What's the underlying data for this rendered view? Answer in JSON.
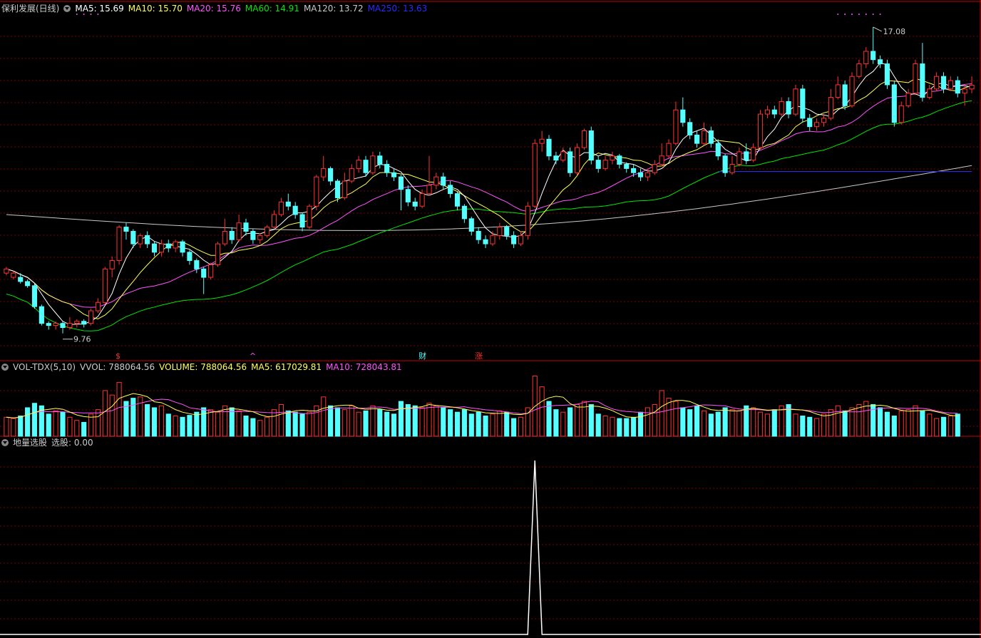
{
  "panel1": {
    "stock_name": "保利发展(日线)",
    "ma_labels": [
      {
        "text": "MA5: 15.69",
        "color": "#ffffff"
      },
      {
        "text": "MA10: 15.70",
        "color": "#ffff54"
      },
      {
        "text": "MA20: 15.76",
        "color": "#ff54ff"
      },
      {
        "text": "MA60: 14.91",
        "color": "#00e600"
      },
      {
        "text": "MA120: 13.72",
        "color": "#c8c8c8"
      },
      {
        "text": "MA250: 13.63",
        "color": "#2a2aff"
      }
    ],
    "high_label": "17.08",
    "low_label": "9.76",
    "event_markers": [
      "$",
      "^",
      "财",
      "涨"
    ]
  },
  "panel2": {
    "indicator_name": "VOL-TDX(5,10)",
    "labels": [
      {
        "text": "VVOL: 788064.56",
        "color": "#cccccc"
      },
      {
        "text": "VOLUME: 788064.56",
        "color": "#ffff54"
      },
      {
        "text": "MA5: 617029.81",
        "color": "#ffff54"
      },
      {
        "text": "MA10: 728043.81",
        "color": "#ff54ff"
      }
    ]
  },
  "panel3": {
    "indicator_name": "地量选股",
    "label": "选股: 0.00"
  },
  "chart_data": {
    "type": "candlestick",
    "price_range": [
      9.5,
      17.3
    ],
    "colors": {
      "up": "#ff3232",
      "down": "#54ffff",
      "grid": "#7a0000",
      "border": "#c80000"
    },
    "candles": [
      [
        11.2,
        11.3,
        11.15,
        11.35
      ],
      [
        11.1,
        11.2,
        11.05,
        11.25
      ],
      [
        11.1,
        11.0,
        10.95,
        11.2
      ],
      [
        11.0,
        10.9,
        10.85,
        11.05
      ],
      [
        10.9,
        10.4,
        10.35,
        10.95
      ],
      [
        10.4,
        10.0,
        9.95,
        10.45
      ],
      [
        10.0,
        9.95,
        9.85,
        10.05
      ],
      [
        9.95,
        10.0,
        9.85,
        10.05
      ],
      [
        10.0,
        9.9,
        9.76,
        10.05
      ],
      [
        9.9,
        10.0,
        9.85,
        10.15
      ],
      [
        10.0,
        10.05,
        9.9,
        10.1
      ],
      [
        10.05,
        9.98,
        9.9,
        10.1
      ],
      [
        10.0,
        10.3,
        9.95,
        10.35
      ],
      [
        10.3,
        10.5,
        10.25,
        10.6
      ],
      [
        10.5,
        11.3,
        10.45,
        11.35
      ],
      [
        11.3,
        11.5,
        11.1,
        11.6
      ],
      [
        11.5,
        12.3,
        11.4,
        12.35
      ],
      [
        12.3,
        12.2,
        12.0,
        12.4
      ],
      [
        12.2,
        11.9,
        11.8,
        12.25
      ],
      [
        11.9,
        12.1,
        11.8,
        12.15
      ],
      [
        12.1,
        11.9,
        11.8,
        12.2
      ],
      [
        11.9,
        11.7,
        11.6,
        11.95
      ],
      [
        11.7,
        11.9,
        11.6,
        12.0
      ],
      [
        11.9,
        11.8,
        11.7,
        12.0
      ],
      [
        11.8,
        11.95,
        11.7,
        12.0
      ],
      [
        11.95,
        11.7,
        11.6,
        12.0
      ],
      [
        11.7,
        11.5,
        11.4,
        11.75
      ],
      [
        11.5,
        11.3,
        11.2,
        11.55
      ],
      [
        11.3,
        11.1,
        10.7,
        11.35
      ],
      [
        11.1,
        11.4,
        11.05,
        11.45
      ],
      [
        11.4,
        11.9,
        11.35,
        11.95
      ],
      [
        11.9,
        12.2,
        11.85,
        12.5
      ],
      [
        12.2,
        12.0,
        11.9,
        12.3
      ],
      [
        12.0,
        12.4,
        11.95,
        12.6
      ],
      [
        12.4,
        12.2,
        12.1,
        12.5
      ],
      [
        12.2,
        12.0,
        11.9,
        12.25
      ],
      [
        12.0,
        12.1,
        11.9,
        12.15
      ],
      [
        12.1,
        12.3,
        12.05,
        12.35
      ],
      [
        12.3,
        12.6,
        12.25,
        12.7
      ],
      [
        12.6,
        12.9,
        12.55,
        13.0
      ],
      [
        12.9,
        12.8,
        12.7,
        13.1
      ],
      [
        12.8,
        12.6,
        12.5,
        12.9
      ],
      [
        12.6,
        12.3,
        12.2,
        12.65
      ],
      [
        12.3,
        12.8,
        12.25,
        12.85
      ],
      [
        12.8,
        13.5,
        12.7,
        13.55
      ],
      [
        13.5,
        13.7,
        13.4,
        14.0
      ],
      [
        13.7,
        13.4,
        13.3,
        13.75
      ],
      [
        13.4,
        13.0,
        12.9,
        13.45
      ],
      [
        13.0,
        13.4,
        12.95,
        13.6
      ],
      [
        13.4,
        13.7,
        13.35,
        13.8
      ],
      [
        13.7,
        13.9,
        13.6,
        14.0
      ],
      [
        13.9,
        13.6,
        13.5,
        14.0
      ],
      [
        13.6,
        14.0,
        13.55,
        14.1
      ],
      [
        14.0,
        13.8,
        13.7,
        14.1
      ],
      [
        13.8,
        13.6,
        13.5,
        13.9
      ],
      [
        13.6,
        13.5,
        13.4,
        13.7
      ],
      [
        13.5,
        13.2,
        12.7,
        13.55
      ],
      [
        13.2,
        12.9,
        12.8,
        13.3
      ],
      [
        12.9,
        12.8,
        12.7,
        13.0
      ],
      [
        12.8,
        13.1,
        12.75,
        13.2
      ],
      [
        13.1,
        13.3,
        13.05,
        14.0
      ],
      [
        13.3,
        13.5,
        13.2,
        13.6
      ],
      [
        13.5,
        13.3,
        13.2,
        13.6
      ],
      [
        13.3,
        13.1,
        13.0,
        13.4
      ],
      [
        13.1,
        12.8,
        12.7,
        13.15
      ],
      [
        12.8,
        12.5,
        12.4,
        12.85
      ],
      [
        12.5,
        12.2,
        12.1,
        12.55
      ],
      [
        12.2,
        12.0,
        11.9,
        12.3
      ],
      [
        12.0,
        11.9,
        11.8,
        12.1
      ],
      [
        11.9,
        12.1,
        11.85,
        12.2
      ],
      [
        12.1,
        12.3,
        12.0,
        12.4
      ],
      [
        12.3,
        12.1,
        12.0,
        12.35
      ],
      [
        12.1,
        11.9,
        11.8,
        12.2
      ],
      [
        11.9,
        12.1,
        11.85,
        12.2
      ],
      [
        12.1,
        12.8,
        12.0,
        12.9
      ],
      [
        12.8,
        14.3,
        12.75,
        14.4
      ],
      [
        14.3,
        14.4,
        14.1,
        14.6
      ],
      [
        14.4,
        14.0,
        13.9,
        14.5
      ],
      [
        14.0,
        13.9,
        13.8,
        14.1
      ],
      [
        13.9,
        14.1,
        13.85,
        14.2
      ],
      [
        14.1,
        13.6,
        13.5,
        14.2
      ],
      [
        13.6,
        14.2,
        13.55,
        14.3
      ],
      [
        14.2,
        14.6,
        14.15,
        14.65
      ],
      [
        14.6,
        13.9,
        13.8,
        14.7
      ],
      [
        13.9,
        13.7,
        13.6,
        14.0
      ],
      [
        13.7,
        13.9,
        13.65,
        14.0
      ],
      [
        13.9,
        14.0,
        13.8,
        14.1
      ],
      [
        14.0,
        13.8,
        13.7,
        14.05
      ],
      [
        13.8,
        13.7,
        13.6,
        13.85
      ],
      [
        13.7,
        13.6,
        13.5,
        13.8
      ],
      [
        13.6,
        13.5,
        13.4,
        13.7
      ],
      [
        13.5,
        13.6,
        13.4,
        13.7
      ],
      [
        13.6,
        13.8,
        13.55,
        13.9
      ],
      [
        13.8,
        14.0,
        13.75,
        14.3
      ],
      [
        14.0,
        14.3,
        13.95,
        14.4
      ],
      [
        14.3,
        15.1,
        14.25,
        15.3
      ],
      [
        15.1,
        14.8,
        14.7,
        15.4
      ],
      [
        14.8,
        14.5,
        14.4,
        14.9
      ],
      [
        14.5,
        14.3,
        14.2,
        14.6
      ],
      [
        14.3,
        14.6,
        14.25,
        14.8
      ],
      [
        14.6,
        14.3,
        14.2,
        14.7
      ],
      [
        14.3,
        14.0,
        13.9,
        14.4
      ],
      [
        14.0,
        13.6,
        13.5,
        14.05
      ],
      [
        13.6,
        13.8,
        13.55,
        14.0
      ],
      [
        13.8,
        14.1,
        13.75,
        14.2
      ],
      [
        14.1,
        13.9,
        13.8,
        14.3
      ],
      [
        13.9,
        14.2,
        13.85,
        14.3
      ],
      [
        14.2,
        15.0,
        14.15,
        15.1
      ],
      [
        15.0,
        15.1,
        14.9,
        15.2
      ],
      [
        15.1,
        15.0,
        14.9,
        15.2
      ],
      [
        15.0,
        15.3,
        14.95,
        15.4
      ],
      [
        15.3,
        15.0,
        14.9,
        15.4
      ],
      [
        15.0,
        15.6,
        14.95,
        15.7
      ],
      [
        15.6,
        14.9,
        14.8,
        15.7
      ],
      [
        14.9,
        14.7,
        14.6,
        15.0
      ],
      [
        14.7,
        14.8,
        14.6,
        14.9
      ],
      [
        14.8,
        14.9,
        14.7,
        15.0
      ],
      [
        14.9,
        15.4,
        14.85,
        15.6
      ],
      [
        15.4,
        15.7,
        15.35,
        15.9
      ],
      [
        15.7,
        15.2,
        15.1,
        15.8
      ],
      [
        15.2,
        15.9,
        15.15,
        16.0
      ],
      [
        15.9,
        16.2,
        15.85,
        16.3
      ],
      [
        16.2,
        16.5,
        16.1,
        16.6
      ],
      [
        16.5,
        16.3,
        16.2,
        17.08
      ],
      [
        16.3,
        16.2,
        16.1,
        16.4
      ],
      [
        16.2,
        15.7,
        15.6,
        16.3
      ],
      [
        15.7,
        14.8,
        14.7,
        15.8
      ],
      [
        14.8,
        15.2,
        14.75,
        15.3
      ],
      [
        15.2,
        15.5,
        15.15,
        15.6
      ],
      [
        15.5,
        16.2,
        15.45,
        16.3
      ],
      [
        16.2,
        15.4,
        15.3,
        16.7
      ],
      [
        15.4,
        15.6,
        15.35,
        15.7
      ],
      [
        15.6,
        15.9,
        15.55,
        16.0
      ],
      [
        15.9,
        15.6,
        15.5,
        16.0
      ],
      [
        15.6,
        15.8,
        15.55,
        15.9
      ],
      [
        15.8,
        15.5,
        15.4,
        15.9
      ],
      [
        15.5,
        15.6,
        15.2,
        15.7
      ],
      [
        15.6,
        15.69,
        15.5,
        15.9
      ]
    ],
    "volumes": [
      0.3,
      0.28,
      0.32,
      0.45,
      0.52,
      0.48,
      0.35,
      0.4,
      0.38,
      0.3,
      0.25,
      0.22,
      0.35,
      0.42,
      0.72,
      0.65,
      0.85,
      0.55,
      0.6,
      0.62,
      0.5,
      0.45,
      0.48,
      0.35,
      0.32,
      0.3,
      0.33,
      0.38,
      0.45,
      0.42,
      0.38,
      0.48,
      0.45,
      0.4,
      0.32,
      0.28,
      0.25,
      0.3,
      0.42,
      0.5,
      0.4,
      0.38,
      0.35,
      0.38,
      0.48,
      0.62,
      0.48,
      0.45,
      0.42,
      0.48,
      0.38,
      0.4,
      0.48,
      0.42,
      0.38,
      0.35,
      0.55,
      0.5,
      0.48,
      0.45,
      0.52,
      0.48,
      0.45,
      0.42,
      0.38,
      0.42,
      0.35,
      0.38,
      0.32,
      0.35,
      0.4,
      0.38,
      0.28,
      0.3,
      0.45,
      0.95,
      0.78,
      0.55,
      0.42,
      0.38,
      0.45,
      0.5,
      0.55,
      0.5,
      0.35,
      0.32,
      0.3,
      0.28,
      0.28,
      0.3,
      0.38,
      0.45,
      0.5,
      0.72,
      0.6,
      0.55,
      0.45,
      0.42,
      0.48,
      0.4,
      0.35,
      0.38,
      0.45,
      0.42,
      0.4,
      0.48,
      0.45,
      0.38,
      0.35,
      0.42,
      0.48,
      0.5,
      0.35,
      0.32,
      0.3,
      0.28,
      0.35,
      0.42,
      0.48,
      0.4,
      0.45,
      0.5,
      0.55,
      0.5,
      0.45,
      0.38,
      0.32,
      0.4,
      0.42,
      0.48,
      0.4,
      0.35,
      0.28,
      0.3,
      0.32,
      0.35
    ],
    "ma5_last": 15.69,
    "ma10_last": 15.7,
    "ma20_last": 15.76,
    "ma60_last": 14.91,
    "ma120_last": 13.72,
    "ma250_last": 13.63,
    "select_signal": {
      "index": 75,
      "value": 1.0,
      "current": 0.0
    }
  }
}
